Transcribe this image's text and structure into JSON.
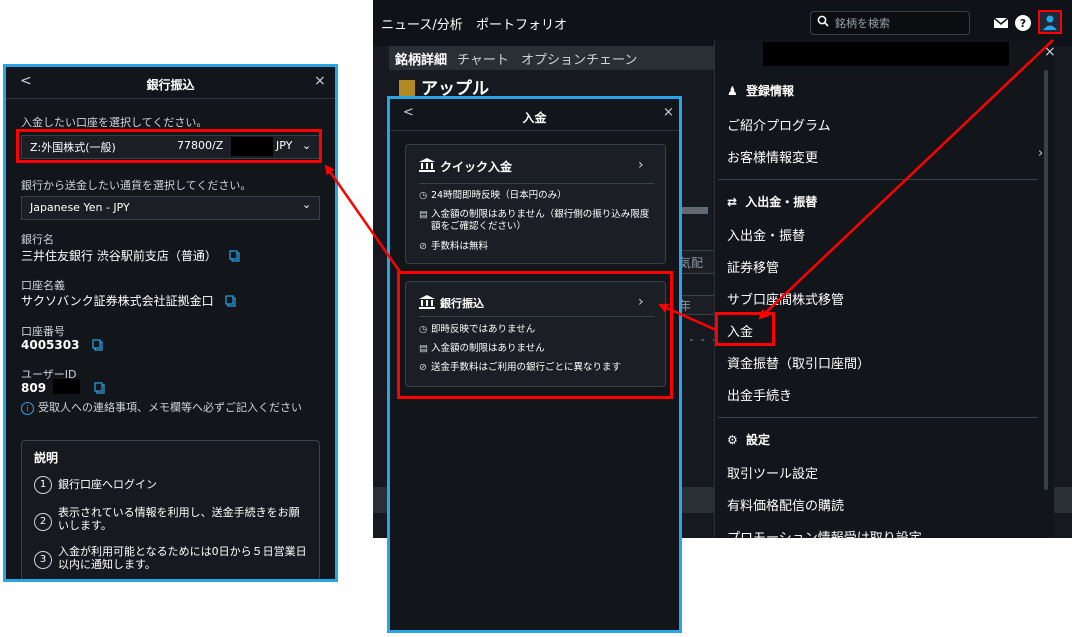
{
  "app": {
    "nav_news": "ニュース/分析",
    "nav_portfolio": "ポートフォリオ",
    "search_placeholder": "銘柄を検索",
    "tabs": [
      "銘柄詳細",
      "チャート",
      "オプションチェーン"
    ],
    "stock_name": "アップル",
    "ghost_text1": "気配",
    "ghost_text2": "年",
    "ghost_dash": "- - - -"
  },
  "menu": {
    "close": "×",
    "section_registration": "登録情報",
    "item_referral": "ご紹介プログラム",
    "item_customer_info": "お客様情報変更",
    "section_funds": "入出金・振替",
    "item_deposit_withdraw": "入出金・振替",
    "item_securities_transfer": "証券移管",
    "item_subaccount_transfer": "サブ口座間株式移管",
    "item_deposit": "入金",
    "item_fund_transfer": "資金振替（取引口座間）",
    "item_withdraw_proc": "出金手続き",
    "section_settings": "設定",
    "item_tool_settings": "取引ツール設定",
    "item_paid_prices": "有料価格配信の購読",
    "item_promo": "プロモーション情報受け取り設定"
  },
  "bank_transfer": {
    "title": "銀行振込",
    "back": "<",
    "close": "×",
    "select_account_label": "入金したい口座を選択してください。",
    "account_name": "Z:外国株式(一般)",
    "account_number": "77800/Z",
    "account_currency": "JPY",
    "select_currency_label": "銀行から送金したい通貨を選択してください。",
    "currency_value": "Japanese Yen - JPY",
    "bank_name_label": "銀行名",
    "bank_name": "三井住友銀行 渋谷駅前支店（普通）",
    "account_holder_label": "口座名義",
    "account_holder": "サクソバンク証券株式会社証拠金口",
    "account_no_label": "口座番号",
    "account_no": "4005303",
    "user_id_label": "ユーザーID",
    "user_id": "809",
    "notice": "受取人への連絡事項、メモ欄等へ必ずご記入ください",
    "desc_title": "説明",
    "steps": [
      {
        "n": "1",
        "text": "銀行口座へログイン"
      },
      {
        "n": "2",
        "text": "表示されている情報を利用し、送金手続きをお願いします。"
      },
      {
        "n": "3",
        "text": "入金が利用可能となるためには0日から５日営業日以内に通知します。"
      }
    ]
  },
  "deposit": {
    "title": "入金",
    "back": "<",
    "close": "×",
    "quick": {
      "title": "クイック入金",
      "row1": "24時間即時反映（日本円のみ）",
      "row2": "入金額の制限はありません（銀行側の振り込み限度額をご確認ください）",
      "row3": "手数料は無料"
    },
    "bank": {
      "title": "銀行振込",
      "row1": "即時反映ではありません",
      "row2": "入金額の制限はありません",
      "row3": "送金手数料はご利用の銀行ごとに異なります"
    }
  },
  "colors": {
    "highlight": "#ff0000",
    "panel_border": "#29a4e8",
    "background": "#12151a"
  }
}
